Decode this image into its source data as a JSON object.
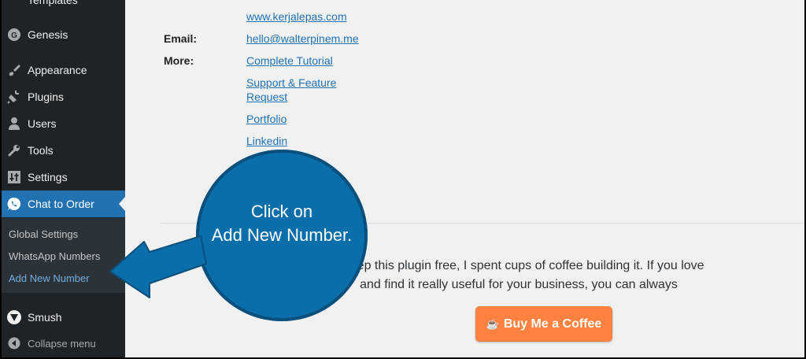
{
  "sidebar": {
    "items": [
      {
        "label": "Templates",
        "icon": "templates-icon"
      },
      {
        "label": "Genesis",
        "icon": "genesis-icon"
      },
      {
        "label": "Appearance",
        "icon": "paintbrush-icon"
      },
      {
        "label": "Plugins",
        "icon": "plug-icon"
      },
      {
        "label": "Users",
        "icon": "user-icon"
      },
      {
        "label": "Tools",
        "icon": "wrench-icon"
      },
      {
        "label": "Settings",
        "icon": "sliders-icon"
      },
      {
        "label": "Chat to Order",
        "icon": "whatsapp-icon"
      }
    ],
    "submenu": [
      "Global Settings",
      "WhatsApp Numbers",
      "Add New Number"
    ],
    "smush": "Smush",
    "collapse": "Collapse menu"
  },
  "info": {
    "website": "www.kerjalepas.com",
    "email_label": "Email:",
    "email": "hello@walterpinem.me",
    "more_label": "More:",
    "links": [
      "Complete Tutorial",
      "Support & Feature",
      "Request",
      "Portfolio",
      "Linkedin"
    ]
  },
  "coffee": {
    "line1": "o keep this plugin free, I spent cups of coffee building it. If you love",
    "line2": "and find it really useful for your business, you can always",
    "button_icon": "☕",
    "button": "Buy Me a Coffee"
  },
  "callout": {
    "line1": "Click on",
    "line2": "Add New Number."
  },
  "colors": {
    "sidebar_bg": "#1d2327",
    "active_bg": "#2271b1",
    "link": "#2271b1",
    "callout": "#0a6eaa",
    "coffee_button": "#ff813f"
  }
}
